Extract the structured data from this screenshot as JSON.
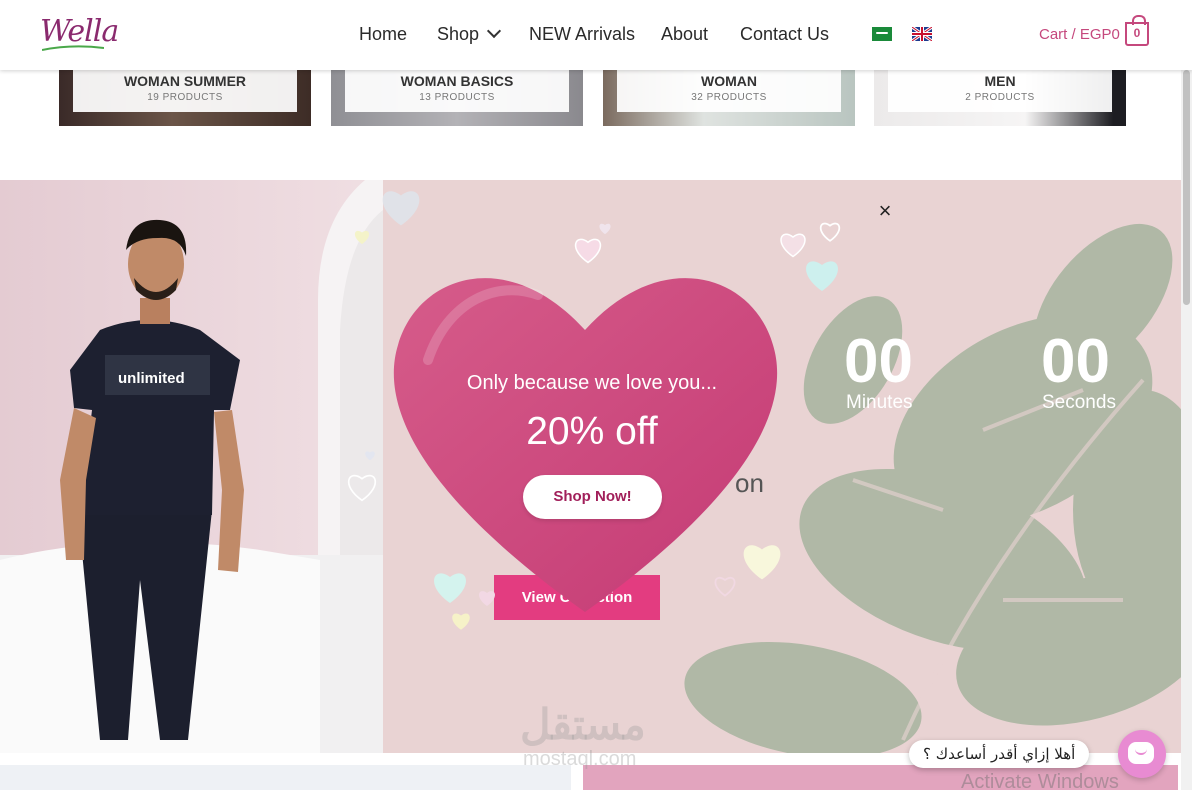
{
  "header": {
    "logo_text": "Wella",
    "nav": [
      "Home",
      "Shop",
      "NEW Arrivals",
      "About",
      "Contact Us"
    ],
    "cart_label": "Cart / EGP0",
    "cart_count": "0"
  },
  "categories": [
    {
      "name": "WOMAN SUMMER",
      "count": "19 PRODUCTS"
    },
    {
      "name": "WOMAN BASICS",
      "count": "13 PRODUCTS"
    },
    {
      "name": "WOMAN",
      "count": "32 PRODUCTS"
    },
    {
      "name": "MEN",
      "count": "2 PRODUCTS"
    }
  ],
  "countdown": {
    "minutes_value": "00",
    "minutes_label": "Minutes",
    "seconds_value": "00",
    "seconds_label": "Seconds"
  },
  "promo": {
    "bg_text_fragment": "on",
    "view_button": "View Collection"
  },
  "popup": {
    "line1": "Only because we love you...",
    "line2": "20% off",
    "button": "Shop Now!",
    "close": "×"
  },
  "tshirt_print": "unlimited",
  "chat": {
    "bubble": "أهلا إزاي أقدر أساعدك ؟"
  },
  "watermark": {
    "arabic": "مستقل",
    "latin": "mostaql.com"
  },
  "os_overlay": "Activate Windows",
  "colors": {
    "accent": "#c5487d",
    "button": "#e33c80",
    "heart": "#d0457c",
    "chat": "#e88bd2"
  }
}
